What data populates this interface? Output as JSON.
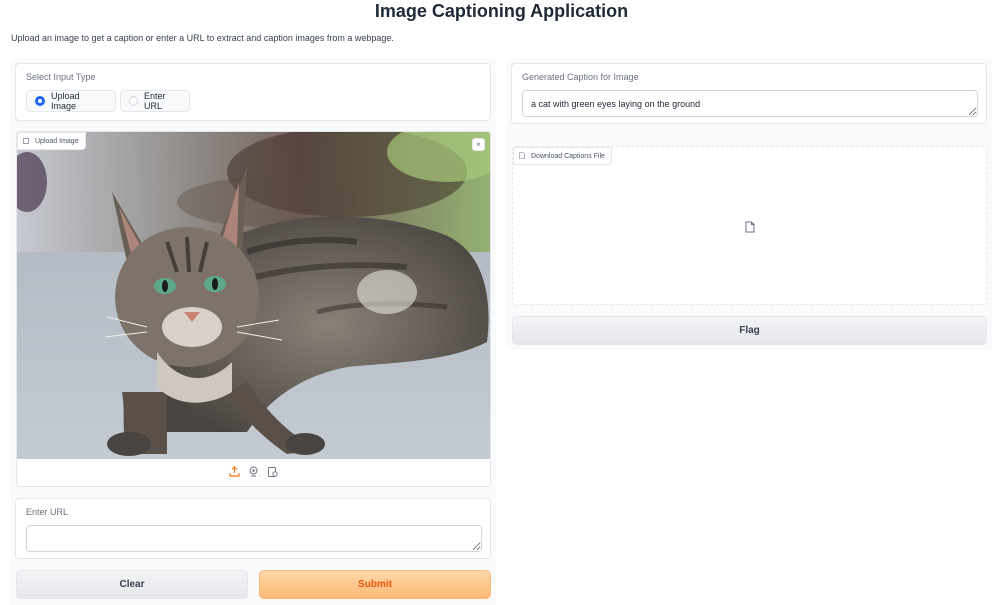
{
  "app": {
    "title": "Image Captioning Application",
    "description": "Upload an image to get a caption or enter a URL to extract and caption images from a webpage."
  },
  "input_type": {
    "label": "Select Input Type",
    "options": [
      "Upload Image",
      "Enter URL"
    ],
    "selected": "Upload Image"
  },
  "image_input": {
    "label": "Upload Image",
    "close_symbol": "×",
    "tools": [
      "upload-icon",
      "webcam-icon",
      "clipboard-icon"
    ]
  },
  "url_input": {
    "label": "Enter URL",
    "value": "",
    "placeholder": ""
  },
  "buttons": {
    "clear": "Clear",
    "submit": "Submit",
    "flag": "Flag"
  },
  "caption_output": {
    "label": "Generated Caption for Image",
    "value": "a cat with green eyes laying on the ground"
  },
  "download": {
    "label": "Download Captions File"
  },
  "colors": {
    "accent_radio": "#2563eb",
    "primary_button": "#fdba74",
    "primary_text": "#ea580c",
    "upload_icon": "#f97316"
  }
}
